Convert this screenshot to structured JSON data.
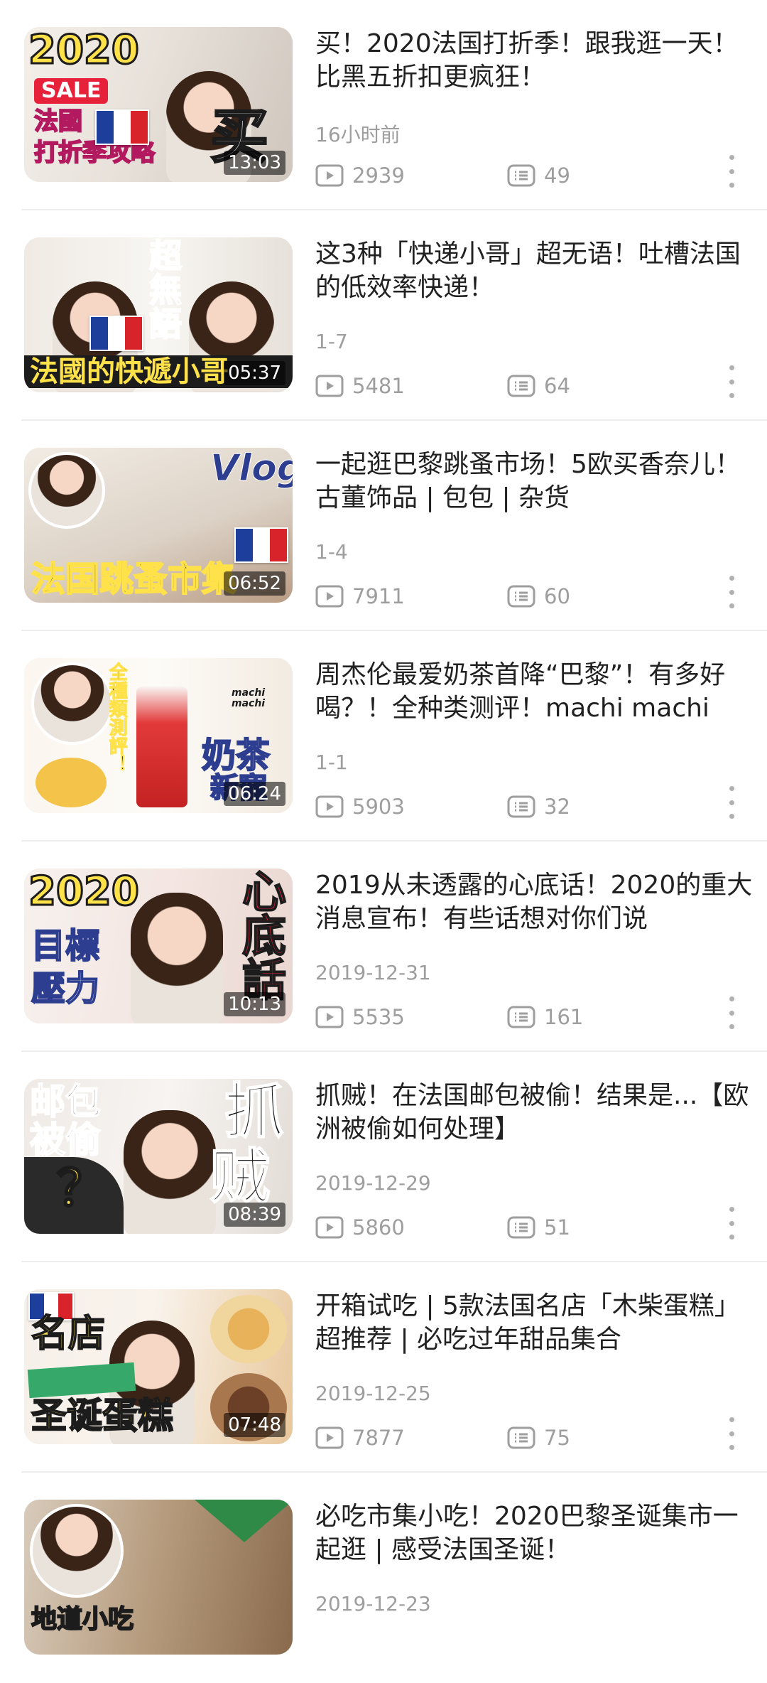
{
  "videos": [
    {
      "title": "买！2020法国打折季！跟我逛一天！比黑五折扣更疯狂！",
      "date": "16小时前",
      "views": "2939",
      "comments": "49",
      "duration": "13:03",
      "thumb_text": [
        "2020",
        "SALE",
        "法國",
        "打折季攻略",
        "买"
      ]
    },
    {
      "title": "这3种「快递小哥」超无语！吐槽法国的低效率快递！",
      "date": "1-7",
      "views": "5481",
      "comments": "64",
      "duration": "05:37",
      "thumb_text": [
        "超",
        "無",
        "語",
        "法國的快遞小哥"
      ]
    },
    {
      "title": "一起逛巴黎跳蚤市场！5欧买香奈儿！古董饰品 | 包包 | 杂货",
      "date": "1-4",
      "views": "7911",
      "comments": "60",
      "duration": "06:52",
      "thumb_text": [
        "Vlog",
        "法国跳蚤市集"
      ]
    },
    {
      "title": "周杰伦最爱奶茶首降“巴黎”！有多好喝？！全种类测评！machi machi",
      "date": "1-1",
      "views": "5903",
      "comments": "32",
      "duration": "06:24",
      "thumb_text": [
        "全種類測評！",
        "奶茶",
        "新寵",
        "machi machi"
      ]
    },
    {
      "title": "2019从未透露的心底话！2020的重大消息宣布！有些话想对你们说",
      "date": "2019-12-31",
      "views": "5535",
      "comments": "161",
      "duration": "10:13",
      "thumb_text": [
        "2020",
        "目標",
        "壓力",
        "心底話"
      ]
    },
    {
      "title": "抓贼！在法国邮包被偷！结果是...【欧洲被偷如何处理】",
      "date": "2019-12-29",
      "views": "5860",
      "comments": "51",
      "duration": "08:39",
      "thumb_text": [
        "邮包",
        "被偷",
        "？",
        "抓",
        "贼"
      ]
    },
    {
      "title": "开箱试吃 | 5款法国名店「木柴蛋糕」超推荐 | 必吃过年甜品集合",
      "date": "2019-12-25",
      "views": "7877",
      "comments": "75",
      "duration": "07:48",
      "thumb_text": [
        "名店",
        "圣诞蛋糕"
      ]
    },
    {
      "title": "必吃市集小吃！2020巴黎圣诞集市一起逛 | 感受法国圣诞！",
      "date": "2019-12-23",
      "views": "",
      "comments": "",
      "duration": "",
      "thumb_text": [
        "地道小吃"
      ]
    }
  ],
  "icons": {
    "views": "play-icon",
    "comments": "comment-icon",
    "more": "more-vertical-icon"
  },
  "colors": {
    "title": "#212121",
    "meta": "#9e9e9e",
    "divider": "#eeeeee"
  }
}
